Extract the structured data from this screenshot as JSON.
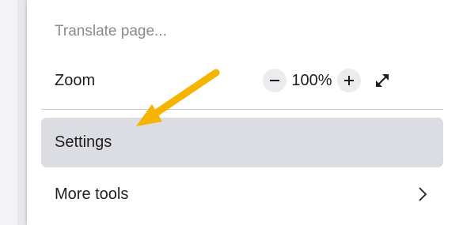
{
  "menu": {
    "translate_label": "Translate page...",
    "zoom": {
      "label": "Zoom",
      "level": "100%",
      "minus_icon": "minus-icon",
      "plus_icon": "plus-icon",
      "fullscreen_icon": "fullscreen-icon"
    },
    "settings_label": "Settings",
    "more_tools_label": "More tools",
    "more_tools_icon": "chevron-right-icon"
  },
  "colors": {
    "highlight_row": "#dcdde3",
    "arrow": "#f5b400",
    "text": "#1f1f1f",
    "muted_text": "#8a8a8a"
  }
}
